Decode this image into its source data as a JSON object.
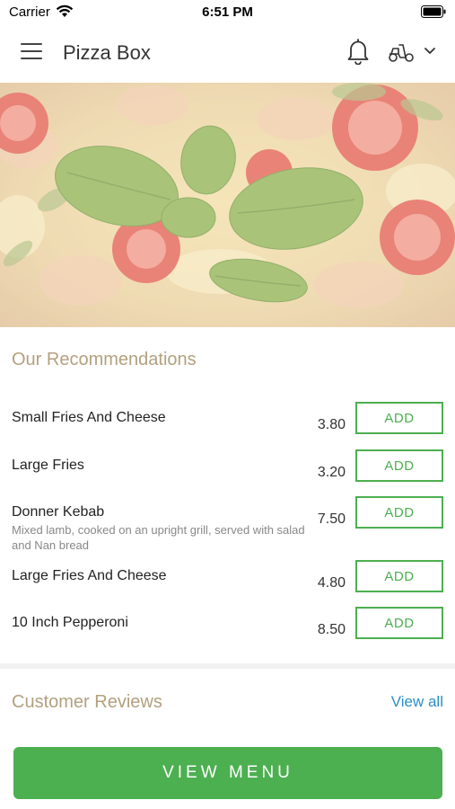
{
  "status_bar": {
    "carrier": "Carrier",
    "time": "6:51 PM"
  },
  "header": {
    "title": "Pizza Box",
    "icons": [
      "menu-icon",
      "bell-icon",
      "scooter-icon",
      "chevron-down-icon"
    ]
  },
  "recommendations": {
    "title": "Our Recommendations",
    "items": [
      {
        "name": "Small Fries And Cheese",
        "description": "",
        "price": "3.80",
        "add_label": "ADD"
      },
      {
        "name": "Large Fries",
        "description": "",
        "price": "3.20",
        "add_label": "ADD"
      },
      {
        "name": "Donner Kebab",
        "description": "Mixed lamb, cooked on an upright grill, served with salad and Nan bread",
        "price": "7.50",
        "add_label": "ADD"
      },
      {
        "name": "Large Fries And Cheese",
        "description": "",
        "price": "4.80",
        "add_label": "ADD"
      },
      {
        "name": "10 Inch Pepperoni",
        "description": "",
        "price": "8.50",
        "add_label": "ADD"
      }
    ]
  },
  "reviews": {
    "title": "Customer Reviews",
    "view_all_label": "View all"
  },
  "footer": {
    "view_menu_label": "VIEW MENU"
  },
  "colors": {
    "accent_green": "#4caf50",
    "section_title": "#b3a07e",
    "link_blue": "#2a8fc7"
  }
}
